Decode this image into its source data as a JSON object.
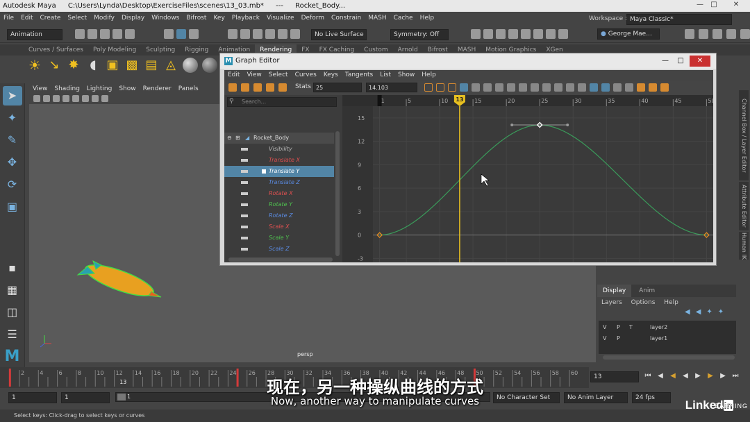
{
  "window": {
    "app": "Autodesk Maya",
    "path": "C:\\Users\\Lynda\\Desktop\\ExerciseFiles\\scenes\\13_03.mb*",
    "separator": "---",
    "object": "Rocket_Body..."
  },
  "menubar": [
    "File",
    "Edit",
    "Create",
    "Select",
    "Modify",
    "Display",
    "Windows",
    "Bifrost",
    "Key",
    "Playback",
    "Visualize",
    "Deform",
    "Constrain",
    "MASH",
    "Cache",
    "Help"
  ],
  "workspace": {
    "label": "Workspace :",
    "value": "Maya Classic*"
  },
  "toolbar": {
    "mode": "Animation",
    "live_surface": "No Live Surface",
    "symmetry": "Symmetry: Off",
    "user": "George Mae..."
  },
  "shelf_tabs": [
    "Curves / Surfaces",
    "Poly Modeling",
    "Sculpting",
    "Rigging",
    "Animation",
    "Rendering",
    "FX",
    "FX Caching",
    "Custom",
    "Arnold",
    "Bifrost",
    "MASH",
    "Motion Graphics",
    "XGen"
  ],
  "shelf_active": "Rendering",
  "viewport": {
    "menu": [
      "View",
      "Shading",
      "Lighting",
      "Show",
      "Renderer",
      "Panels"
    ],
    "camera": "persp"
  },
  "graph_editor": {
    "title": "Graph Editor",
    "menu": [
      "Edit",
      "View",
      "Select",
      "Curves",
      "Keys",
      "Tangents",
      "List",
      "Show",
      "Help"
    ],
    "stats_label": "Stats",
    "stats_frame": "25",
    "stats_value": "14.103",
    "search_placeholder": "Search...",
    "outliner": {
      "root": "Rocket_Body",
      "channels": [
        {
          "name": "Visibility",
          "color": "#bbbbbb",
          "selected": false
        },
        {
          "name": "Translate X",
          "color": "#e05050",
          "selected": false
        },
        {
          "name": "Translate Y",
          "color": "#ffffff",
          "selected": true
        },
        {
          "name": "Translate Z",
          "color": "#5a8ae0",
          "selected": false
        },
        {
          "name": "Rotate X",
          "color": "#e05050",
          "selected": false
        },
        {
          "name": "Rotate Y",
          "color": "#4fc04f",
          "selected": false
        },
        {
          "name": "Rotate Z",
          "color": "#5a8ae0",
          "selected": false
        },
        {
          "name": "Scale X",
          "color": "#e05050",
          "selected": false
        },
        {
          "name": "Scale Y",
          "color": "#4fc04f",
          "selected": false
        },
        {
          "name": "Scale Z",
          "color": "#5a8ae0",
          "selected": false
        }
      ]
    },
    "time_ruler": [
      "1",
      "5",
      "10",
      "15",
      "20",
      "25",
      "30",
      "35",
      "40",
      "45",
      "50"
    ],
    "current_frame": "13",
    "value_axis": [
      "15",
      "12",
      "9",
      "6",
      "3",
      "0",
      "-3"
    ]
  },
  "chart_data": {
    "type": "line",
    "title": "",
    "xlabel": "",
    "ylabel": "",
    "xlim": [
      0,
      51
    ],
    "ylim": [
      -3.5,
      16.5
    ],
    "keys": [
      {
        "frame": 1,
        "value": 0
      },
      {
        "frame": 25,
        "value": 14.1
      },
      {
        "frame": 50,
        "value": 0
      }
    ],
    "series": [
      {
        "color": "#3a9a5a",
        "points": [
          [
            1,
            0
          ],
          [
            25,
            14.1
          ],
          [
            50,
            0
          ]
        ]
      }
    ],
    "key_color": "#e08a20",
    "current_frame": 13,
    "grid": true
  },
  "layer_panel": {
    "tabs": [
      "Display",
      "Anim"
    ],
    "menu": [
      "Layers",
      "Options",
      "Help"
    ],
    "layers": [
      {
        "v": "V",
        "p": "P",
        "t": "T",
        "name": "layer2"
      },
      {
        "v": "V",
        "p": "P",
        "t": "",
        "name": "layer1"
      }
    ]
  },
  "side_tabs": [
    "Channel Box / Layer Editor",
    "Attribute Editor",
    "Human IK"
  ],
  "timeslider": {
    "ticks": [
      "2",
      "4",
      "6",
      "8",
      "10",
      "12",
      "14",
      "16",
      "18",
      "20",
      "22",
      "24",
      "26",
      "28",
      "30",
      "32",
      "34",
      "36",
      "38",
      "40",
      "42",
      "44",
      "46",
      "48",
      "50",
      "52",
      "54",
      "56",
      "58",
      "60"
    ],
    "current": "13",
    "current_field": "13"
  },
  "range": {
    "start": "1",
    "inner_start": "1",
    "slider_start": "1",
    "character_set": "No Character Set",
    "anim_layer": "No Anim Layer",
    "fps": "24 fps"
  },
  "help_line": "Select keys: Click-drag to select keys or curves",
  "subtitles": {
    "zh": "现在，另一种操纵曲线的方式",
    "en": "Now, another way to manipulate curves"
  },
  "branding": {
    "name": "Linked",
    "in": "in",
    "suffix": "LEARNING"
  }
}
